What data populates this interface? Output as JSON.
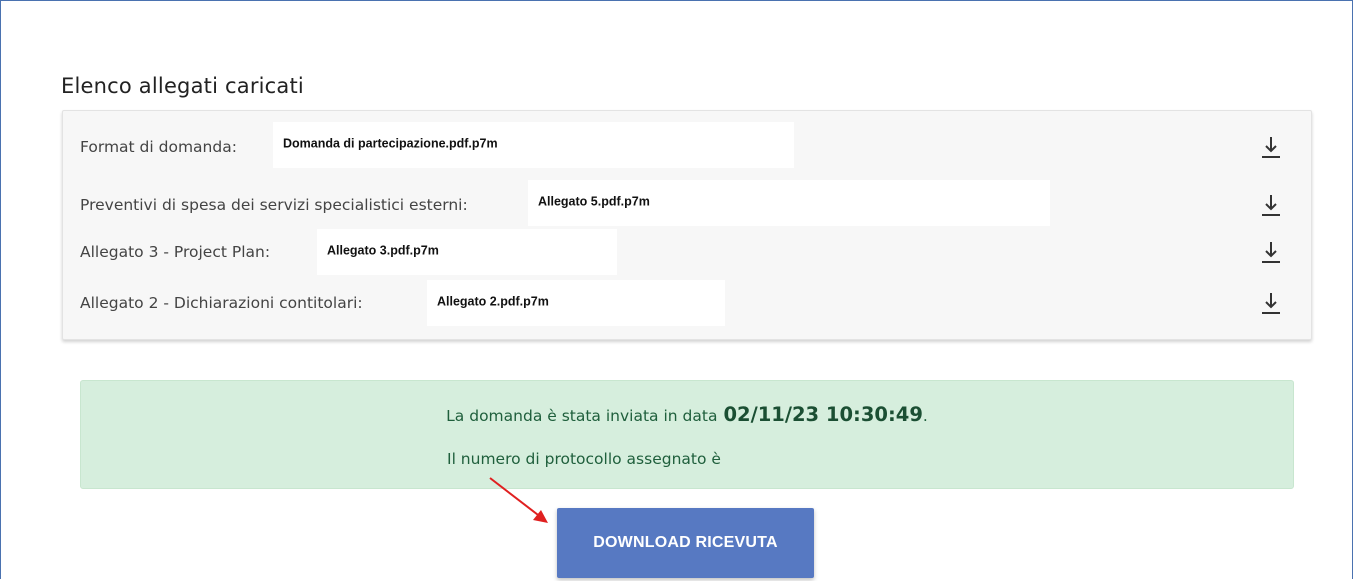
{
  "section": {
    "title": "Elenco allegati caricati"
  },
  "attachments": [
    {
      "label": "Format di domanda:",
      "file": "Domanda di partecipazione.pdf.p7m",
      "icon": "download-icon"
    },
    {
      "label": "Preventivi di spesa dei servizi specialistici esterni:",
      "file": "Allegato 5.pdf.p7m",
      "icon": "download-icon"
    },
    {
      "label": "Allegato 3 - Project Plan:",
      "file": "Allegato 3.pdf.p7m",
      "icon": "download-icon"
    },
    {
      "label": "Allegato 2 - Dichiarazioni contitolari:",
      "file": "Allegato 2.pdf.p7m",
      "icon": "download-icon"
    }
  ],
  "alert": {
    "sent_text": "La domanda è stata inviata in data",
    "sent_date": "02/11/23 10:30:49",
    "sent_suffix": ".",
    "protocol_text": "Il numero di protocollo assegnato è"
  },
  "download_button": {
    "label": "DOWNLOAD RICEVUTA"
  },
  "colors": {
    "alert_bg": "#d6eedd",
    "button_bg": "#5779c2",
    "arrow": "#e02020",
    "frame_border": "#4a72b0"
  }
}
